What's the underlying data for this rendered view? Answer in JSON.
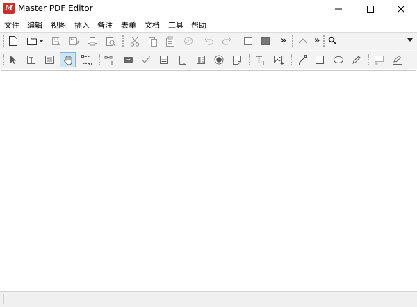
{
  "window": {
    "title": "Master PDF Editor",
    "app_icon": "master-pdf-logo-icon",
    "controls": [
      "minimize-icon",
      "maximize-icon",
      "close-icon"
    ]
  },
  "menubar": {
    "items": [
      {
        "label": "文件"
      },
      {
        "label": "编辑"
      },
      {
        "label": "视图"
      },
      {
        "label": "插入"
      },
      {
        "label": "备注"
      },
      {
        "label": "表单"
      },
      {
        "label": "文档"
      },
      {
        "label": "工具"
      },
      {
        "label": "帮助"
      }
    ]
  },
  "toolbar_main": {
    "buttons": [
      "new-document-icon",
      "open-folder-icon",
      "dropdown-arrow-icon",
      "save-icon",
      "save-as-icon",
      "print-icon",
      "print-preview-icon",
      "cut-icon",
      "copy-icon",
      "paste-icon",
      "delete-icon",
      "undo-icon",
      "redo-icon",
      "stroke-color-icon",
      "fill-color-icon",
      "overflow-chevron-icon",
      "navigate-up-icon",
      "overflow-chevron-icon"
    ],
    "overflow_glyph": "»"
  },
  "search": {
    "placeholder": "",
    "value": "",
    "icon": "search-icon"
  },
  "toolbar_tools": {
    "buttons": [
      "select-arrow-icon",
      "text-select-icon",
      "edit-document-icon",
      "hand-tool-icon",
      "select-area-icon",
      "link-tool-icon",
      "text-field-icon",
      "checkbox-icon",
      "list-box-icon",
      "combo-box-icon",
      "button-form-icon",
      "radio-button-icon",
      "signature-icon",
      "add-text-icon",
      "add-image-icon",
      "line-icon",
      "rectangle-icon",
      "ellipse-icon",
      "pencil-icon",
      "comment-box-icon",
      "highlight-pen-icon"
    ],
    "active": "hand-tool-icon"
  },
  "colors": {
    "active_bg": "#cde6f7",
    "active_border": "#7eb4ea",
    "toolbar_bg": "#f3f3f3",
    "logo_red": "#c9302c"
  }
}
